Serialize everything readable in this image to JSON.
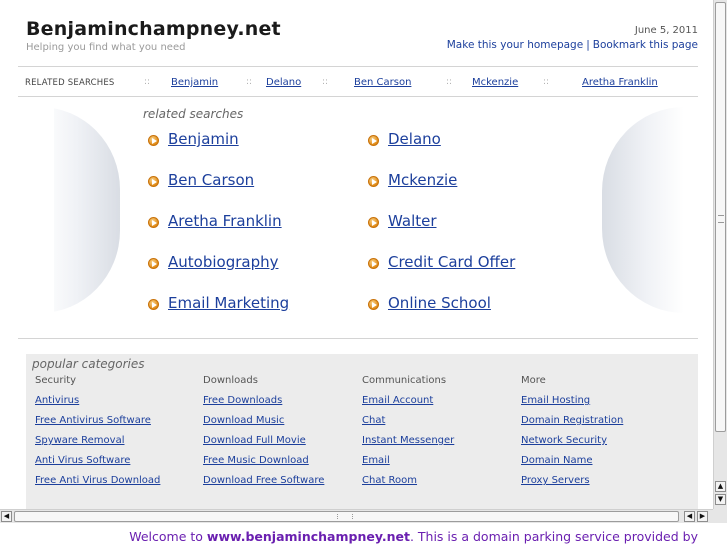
{
  "header": {
    "site_title": "Benjaminchampney.net",
    "tagline": "Helping you find what you need",
    "date": "June 5, 2011",
    "make_homepage": "Make this your homepage",
    "separator": "|",
    "bookmark": "Bookmark this page"
  },
  "related_bar": {
    "label": "RELATED SEARCHES",
    "links": [
      "Benjamin",
      "Delano",
      "Ben Carson",
      "Mckenzie",
      "Aretha Franklin"
    ]
  },
  "results": {
    "title": "related searches",
    "items": [
      "Benjamin",
      "Delano",
      "Ben Carson",
      "Mckenzie",
      "Aretha Franklin",
      "Walter",
      "Autobiography",
      "Credit Card Offer",
      "Email Marketing",
      "Online School"
    ]
  },
  "popular": {
    "title": "popular categories",
    "columns": [
      {
        "heading": "Security",
        "links": [
          "Antivirus",
          "Free Antivirus Software",
          "Spyware Removal",
          "Anti Virus Software",
          "Free Anti Virus Download"
        ]
      },
      {
        "heading": "Downloads",
        "links": [
          "Free Downloads",
          "Download Music",
          "Download Full Movie",
          "Free Music Download",
          "Download Free Software"
        ]
      },
      {
        "heading": "Communications",
        "links": [
          "Email Account",
          "Chat",
          "Instant Messenger",
          "Email",
          "Chat Room"
        ]
      },
      {
        "heading": "More",
        "links": [
          "Email Hosting",
          "Domain Registration",
          "Network Security",
          "Domain Name",
          "Proxy Servers"
        ]
      }
    ]
  },
  "footer": {
    "prefix": "Welcome to ",
    "domain": "www.benjaminchampney.net",
    "suffix": ". This is a domain parking service provided by"
  },
  "colors": {
    "link": "#1c3f9c",
    "footer": "#6a1fb0",
    "arrow": "#e08a16"
  },
  "icons": {
    "result_bullet": "orange-arrow-circle-icon"
  }
}
